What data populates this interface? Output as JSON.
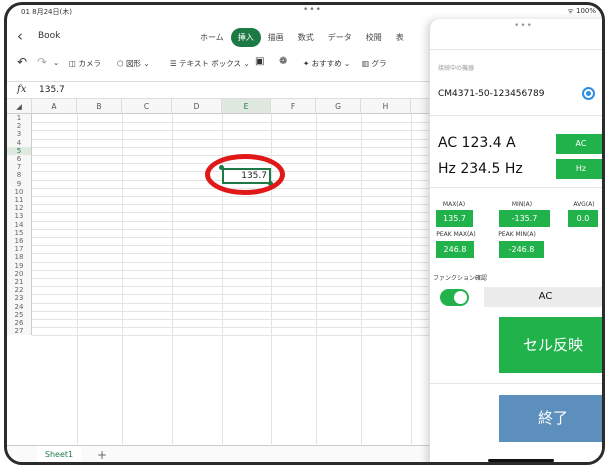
{
  "status": {
    "time": "01 8月24日(木)",
    "battery": "100%"
  },
  "toolbar": {
    "back_icon": "chevron-left-icon",
    "book_name": "Book",
    "tabs": [
      {
        "label": "ホーム",
        "active": false
      },
      {
        "label": "挿入",
        "active": true
      },
      {
        "label": "描画",
        "active": false
      },
      {
        "label": "数式",
        "active": false
      },
      {
        "label": "データ",
        "active": false
      },
      {
        "label": "校閲",
        "active": false
      },
      {
        "label": "表",
        "active": false
      }
    ],
    "ribbon": [
      {
        "label": "カメラ"
      },
      {
        "label": "図形 ⌄"
      },
      {
        "label": "テキスト ボックス ⌄"
      },
      {
        "label": "おすすめ ⌄"
      },
      {
        "label": "グラ"
      }
    ]
  },
  "formula_bar": {
    "fx": "fx",
    "value": "135.7"
  },
  "sheet": {
    "columns": [
      "A",
      "B",
      "C",
      "D",
      "E",
      "F",
      "G",
      "H"
    ],
    "rows": [
      "1",
      "2",
      "3",
      "4",
      "5",
      "6",
      "7",
      "8",
      "9",
      "10",
      "11",
      "12",
      "13",
      "14",
      "15",
      "16",
      "17",
      "18",
      "19",
      "20",
      "21",
      "22",
      "23",
      "24",
      "25",
      "26",
      "27"
    ],
    "selected_cell": "E5",
    "selected_value": "135.7",
    "tab": "Sheet1",
    "add_sheet": "+"
  },
  "panel": {
    "device_label": "接続中の機器",
    "device_id": "CM4371-50-123456789",
    "ac_reading": "AC 123.4 A",
    "ac_button": "AC",
    "hz_reading": "Hz 234.5 Hz",
    "hz_button": "Hz",
    "stats": {
      "max_label": "MAX(A)",
      "max_value": "135.7",
      "min_label": "MIN(A)",
      "min_value": "-135.7",
      "avg_label": "AVG(A)",
      "avg_value": "0.0",
      "peak_max_label": "PEAK MAX(A)",
      "peak_max_value": "246.8",
      "peak_min_label": "PEAK MIN(A)",
      "peak_min_value": "-246.8"
    },
    "function_label": "ファンクション確認",
    "function_toggle": true,
    "function_value": "AC",
    "cell_reflect_button": "セル反映",
    "end_button": "終了"
  },
  "colors": {
    "excel_green": "#1e7a45",
    "button_green": "#22b24c",
    "end_blue": "#5d8fbd",
    "annotation_red": "#e11818"
  }
}
